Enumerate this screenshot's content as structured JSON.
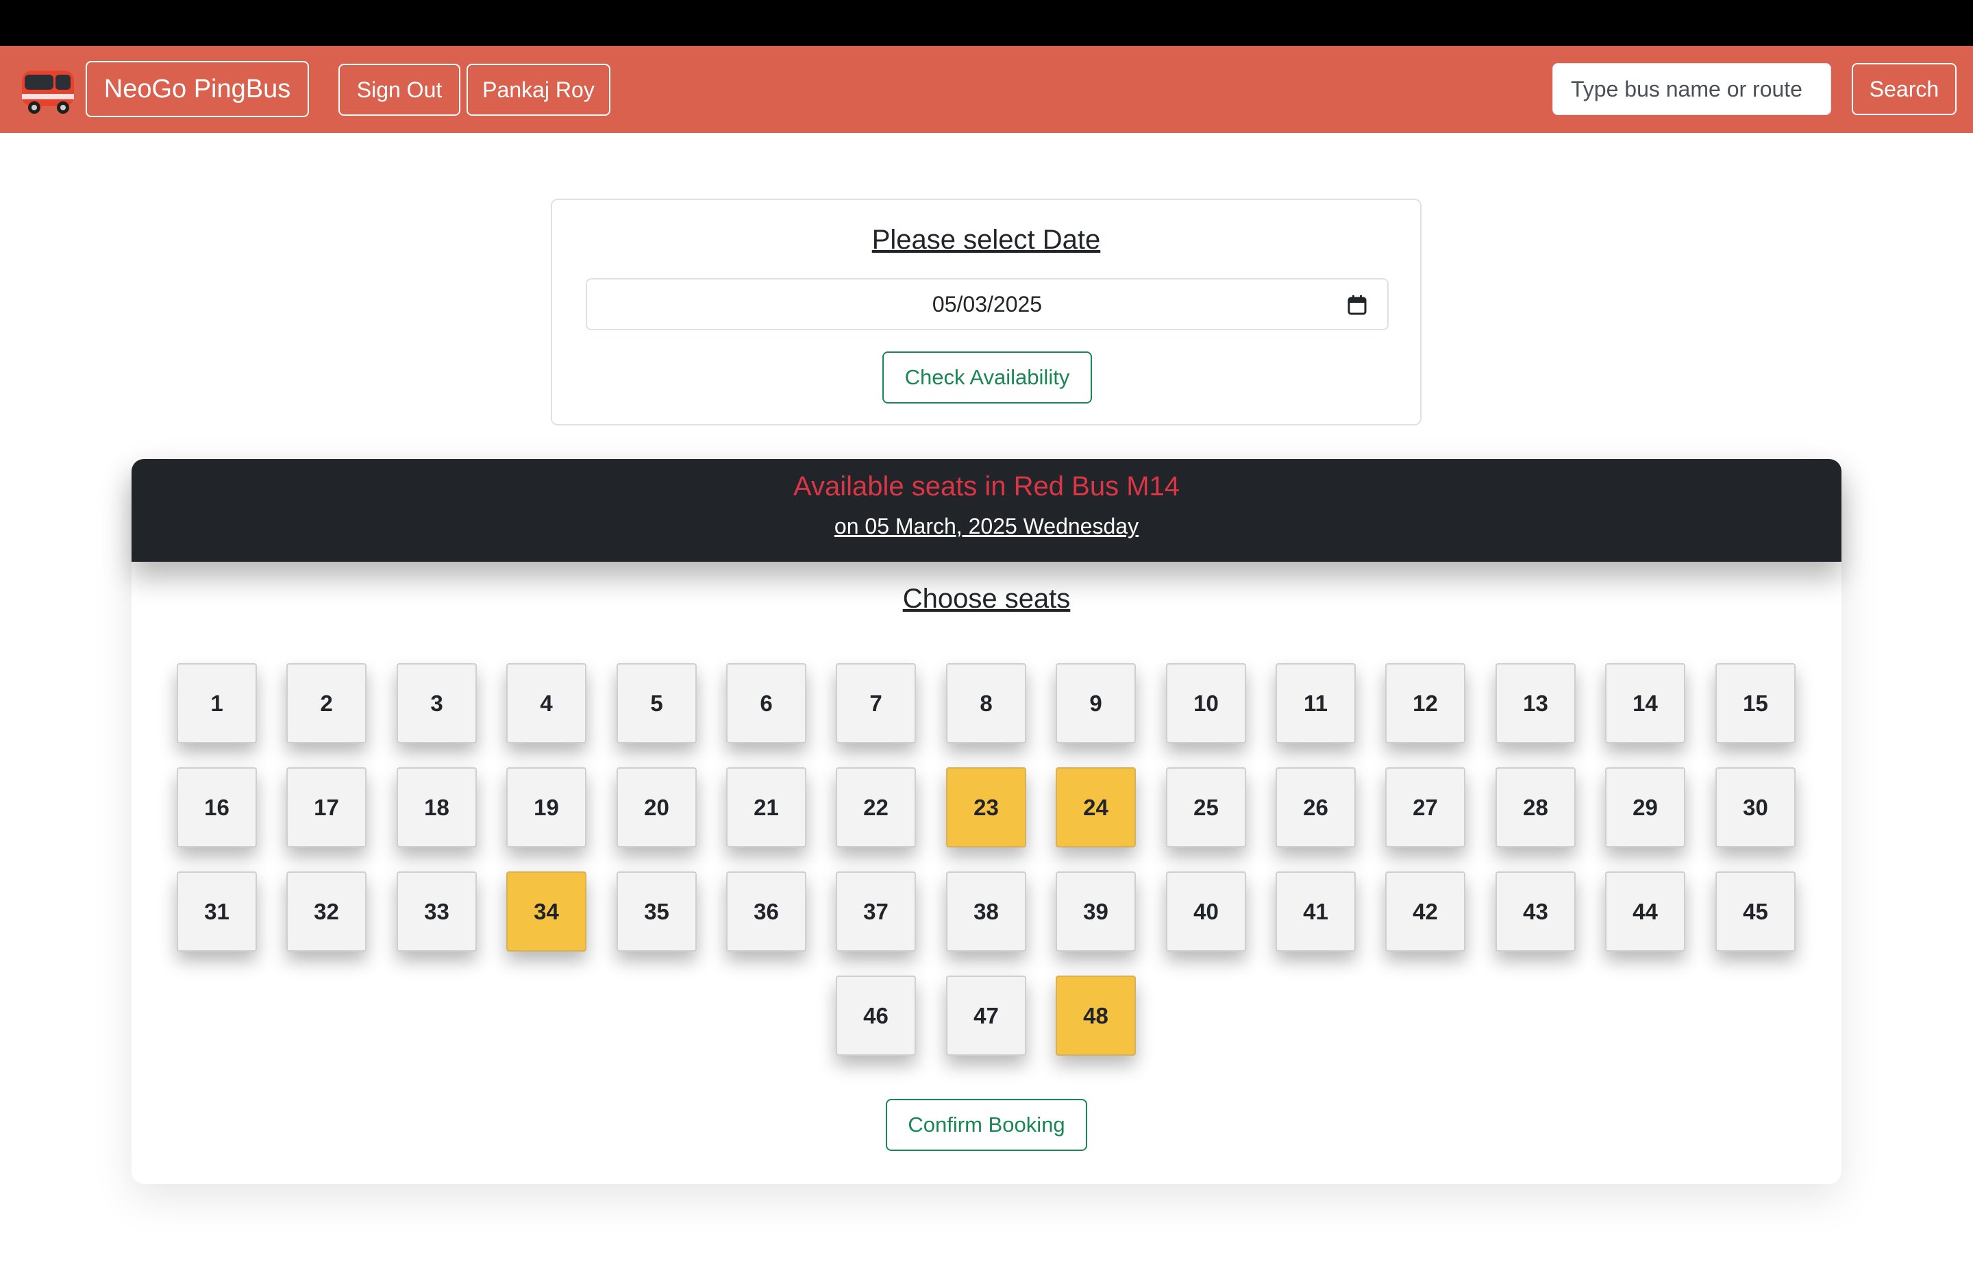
{
  "navbar": {
    "brand": "NeoGo PingBus",
    "sign_out": "Sign Out",
    "user_name": "Pankaj Roy",
    "search_placeholder": "Type bus name or route",
    "search_label": "Search",
    "logo_icon": "bus-logo-icon"
  },
  "date_card": {
    "title": "Please select Date",
    "date_value": "05/03/2025",
    "check_label": "Check Availability"
  },
  "seat_card": {
    "title": "Available seats in Red Bus M14",
    "subtitle": "on 05 March, 2025 Wednesday",
    "choose_title": "Choose seats",
    "confirm_label": "Confirm Booking",
    "seats": [
      "1",
      "2",
      "3",
      "4",
      "5",
      "6",
      "7",
      "8",
      "9",
      "10",
      "11",
      "12",
      "13",
      "14",
      "15",
      "16",
      "17",
      "18",
      "19",
      "20",
      "21",
      "22",
      "23",
      "24",
      "25",
      "26",
      "27",
      "28",
      "29",
      "30",
      "31",
      "32",
      "33",
      "34",
      "35",
      "36",
      "37",
      "38",
      "39",
      "40",
      "41",
      "42",
      "43",
      "44",
      "45",
      "46",
      "47",
      "48"
    ],
    "selected_seats": [
      "23",
      "24",
      "34",
      "48"
    ]
  },
  "colors": {
    "navbar": "#d9614e",
    "header_dark": "#212529",
    "title_red": "#dc3545",
    "success": "#198754",
    "seat_selected": "#f5c242",
    "seat_default": "#f3f3f3"
  }
}
